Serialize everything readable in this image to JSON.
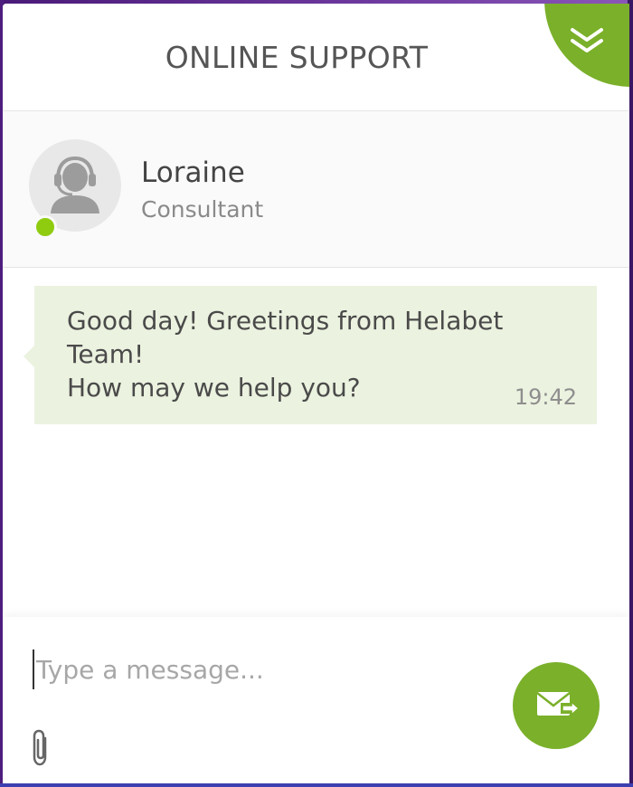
{
  "header": {
    "title": "ONLINE SUPPORT",
    "collapse_icon": "double-chevron-down-icon"
  },
  "agent": {
    "name": "Loraine",
    "role": "Consultant",
    "avatar_icon": "headset-operator-icon",
    "status": "online",
    "status_color": "#8fcc10"
  },
  "messages": [
    {
      "text": "Good day! Greetings from Helabet Team!\nHow may we help you?",
      "time": "19:42"
    }
  ],
  "composer": {
    "placeholder": "Type a message...",
    "value": "",
    "attach_icon": "paperclip-icon",
    "send_icon": "send-envelope-icon"
  },
  "colors": {
    "accent": "#7ab02a",
    "bubble": "#ebf2df",
    "page_background": "#5b2a8a"
  }
}
